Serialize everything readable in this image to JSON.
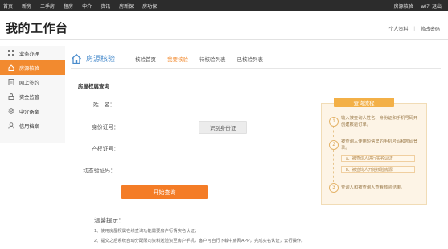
{
  "topnav": {
    "items": [
      "首页",
      "新房",
      "二手房",
      "租房",
      "中介",
      "资讯",
      "房新保",
      "房功保"
    ],
    "user_link": "房源核验",
    "user_name": "a07, 退出"
  },
  "header": {
    "title": "我的工作台",
    "link_profile": "个人资料",
    "separator": "|",
    "link_password": "修改密码"
  },
  "sidebar": {
    "items": [
      {
        "label": "业务办理",
        "icon": "grid-icon"
      },
      {
        "label": "房源核验",
        "icon": "house-icon",
        "active": true
      },
      {
        "label": "网上签约",
        "icon": "document-icon"
      },
      {
        "label": "资金监管",
        "icon": "lock-icon"
      },
      {
        "label": "中介备案",
        "icon": "layers-icon"
      },
      {
        "label": "信用档案",
        "icon": "user-icon"
      }
    ]
  },
  "main": {
    "section_title": "房源核验",
    "tabs": [
      {
        "label": "核验首页",
        "active": false
      },
      {
        "label": "我要核验",
        "active": true
      },
      {
        "label": "待核验列表",
        "active": false
      },
      {
        "label": "已核验列表",
        "active": false
      }
    ]
  },
  "form": {
    "title": "房屋权属查询",
    "name_label": "姓　名：",
    "id_label": "身份证号：",
    "id_button": "识别身份证",
    "cert_label": "产权证号：",
    "code_label": "动态验证码：",
    "submit_label": "开始查询"
  },
  "tips": {
    "title": "温馨提示：",
    "items": [
      "1、使用房屋权属在线查询功能需要房户行情实名认证；",
      "2、提交之后系统自动分配限司资料送验资至房户手机，客户可自行下载中房网APP，完成实名认证，去行操作。"
    ]
  },
  "flow": {
    "title": "查询流程",
    "steps": [
      {
        "number": "1",
        "text": "输入被查询人姓名、身份证和手机号码开创建核验订单。"
      },
      {
        "number": "2",
        "text": "被查询人使用短信里的手机号码和密码登录。"
      },
      {
        "number": "3",
        "text": "查询人和被查询人查看核验结果。"
      }
    ],
    "substeps": [
      "a、被查询人进行实名认证",
      "b、被查询人开始核验房源"
    ]
  },
  "colors": {
    "accent_orange": "#f47c26",
    "active_sidebar": "#f28a2f",
    "tab_blue": "#4a8ccc",
    "flow_title": "#f3b047",
    "topbar": "#2c2c2c"
  }
}
